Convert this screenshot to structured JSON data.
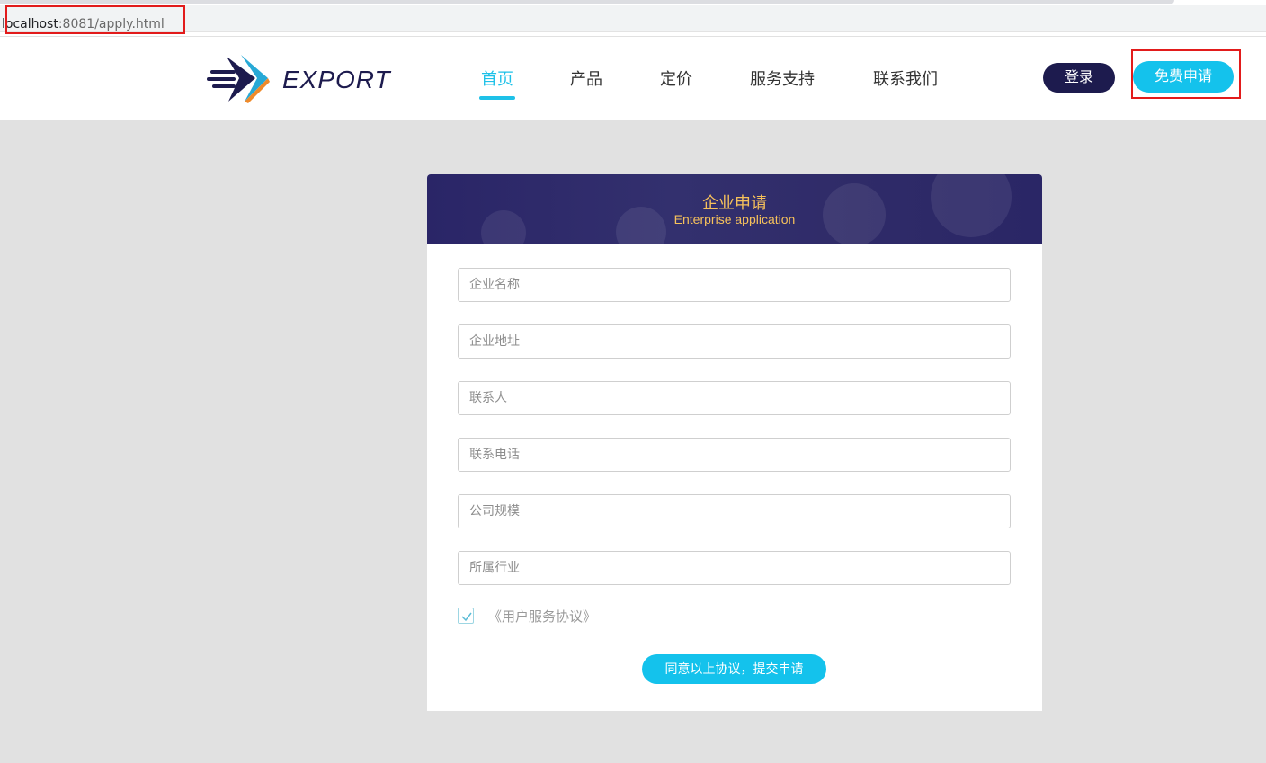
{
  "browser": {
    "url_host": "localhost",
    "url_rest": ":8081/apply.html"
  },
  "header": {
    "logo_text": "EXPORT",
    "nav": [
      {
        "label": "首页",
        "active": true
      },
      {
        "label": "产品",
        "active": false
      },
      {
        "label": "定价",
        "active": false
      },
      {
        "label": "服务支持",
        "active": false
      },
      {
        "label": "联系我们",
        "active": false
      }
    ],
    "login_label": "登录",
    "apply_label": "免费申请"
  },
  "form": {
    "title": "企业申请",
    "subtitle": "Enterprise application",
    "fields": [
      {
        "placeholder": "企业名称"
      },
      {
        "placeholder": "企业地址"
      },
      {
        "placeholder": "联系人"
      },
      {
        "placeholder": "联系电话"
      },
      {
        "placeholder": "公司规模"
      },
      {
        "placeholder": "所属行业"
      }
    ],
    "agreement_label": "《用户服务协议》",
    "agreement_checked": true,
    "submit_label": "同意以上协议，提交申请"
  },
  "colors": {
    "accent": "#14c2ec",
    "dark": "#1d1b4e",
    "gold": "#f6c15b",
    "highlight_box": "#e21b1b"
  }
}
